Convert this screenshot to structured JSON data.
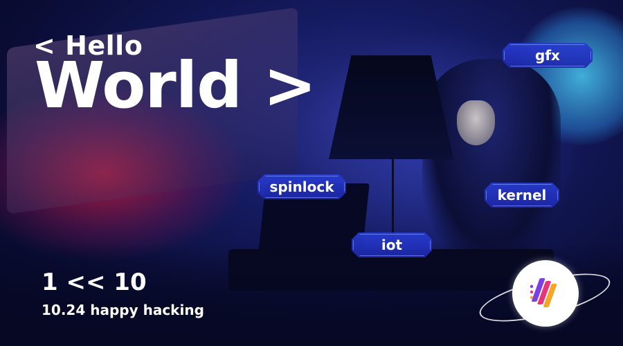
{
  "headline": {
    "small": "< Hello",
    "big": "World >"
  },
  "tags": {
    "gfx": "gfx",
    "spinlock": "spinlock",
    "kernel": "kernel",
    "iot": "iot"
  },
  "footer": {
    "shift": "1 << 10",
    "subtitle": "10.24 happy hacking"
  },
  "logo": {
    "icon": "stacked-bars-logo-icon",
    "colors": [
      "#7b3fe4",
      "#e6357a",
      "#f5a623"
    ]
  },
  "colors": {
    "background": "#0a0d36",
    "tag": "#2a3fd0",
    "text": "#ffffff"
  }
}
